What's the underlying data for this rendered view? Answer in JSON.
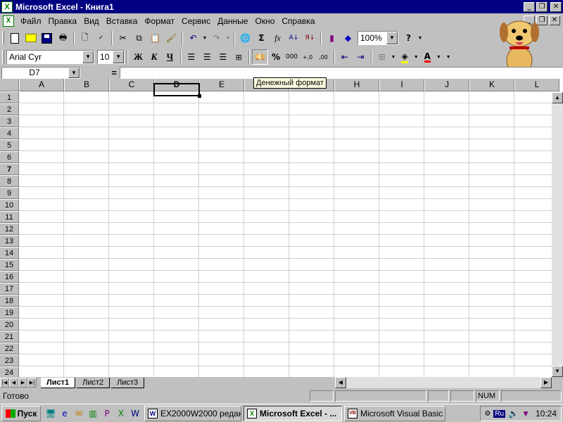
{
  "window": {
    "title": "Microsoft Excel - Книга1"
  },
  "caption_buttons": {
    "minimize": "_",
    "restore": "❐",
    "close": "✕"
  },
  "menu": [
    "Файл",
    "Правка",
    "Вид",
    "Вставка",
    "Формат",
    "Сервис",
    "Данные",
    "Окно",
    "Справка"
  ],
  "standard_toolbar": {
    "zoom": "100%"
  },
  "format_toolbar": {
    "font_name": "Arial Cyr",
    "font_size": "10",
    "bold": "Ж",
    "italic": "К",
    "underline": "Ч",
    "percent": "%",
    "thousands": "000",
    "inc_decimal": "+,0",
    "dec_decimal": ",00"
  },
  "formula_bar": {
    "name_box": "D7",
    "equals": "=",
    "formula": ""
  },
  "tooltip": "Денежный формат",
  "grid": {
    "columns": [
      "A",
      "B",
      "C",
      "D",
      "E",
      "F",
      "G",
      "H",
      "I",
      "J",
      "K",
      "L"
    ],
    "rows": [
      "1",
      "2",
      "3",
      "4",
      "5",
      "6",
      "7",
      "8",
      "9",
      "10",
      "11",
      "12",
      "13",
      "14",
      "15",
      "16",
      "17",
      "18",
      "19",
      "20",
      "21",
      "22",
      "23",
      "24"
    ],
    "active_column": "D",
    "active_row": "7"
  },
  "sheets": {
    "tabs": [
      "Лист1",
      "Лист2",
      "Лист3"
    ],
    "active": "Лист1"
  },
  "status": {
    "text": "Готово",
    "num": "NUM"
  },
  "taskbar": {
    "start": "Пуск",
    "tasks": [
      {
        "label": "EX2000W2000 редак...",
        "icon": "W"
      },
      {
        "label": "Microsoft Excel - ...",
        "icon": "X"
      },
      {
        "label": "Microsoft Visual Basic ...",
        "icon": "VB"
      }
    ],
    "lang": "Ru",
    "clock": "10:24"
  }
}
